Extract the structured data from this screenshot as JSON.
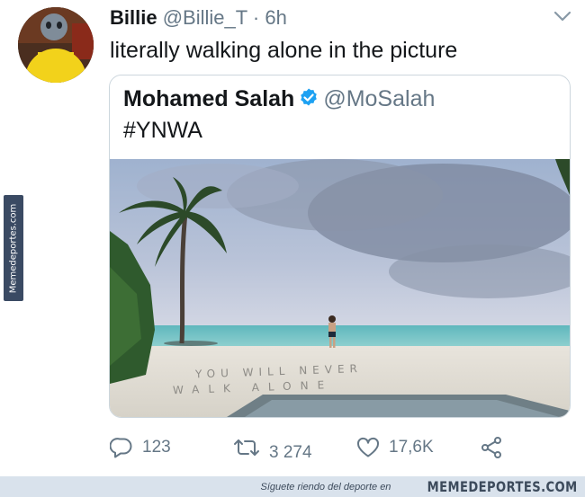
{
  "watermark": {
    "side_text": "Memedeportes.com"
  },
  "tweet": {
    "author_name": "Billie",
    "author_handle": "@Billie_T",
    "separator": "·",
    "time": "6h",
    "text": "literally walking alone in the picture",
    "menu_icon": "chevron-down-icon"
  },
  "quote": {
    "author_name": "Mohamed Salah",
    "verified_icon": "verified-badge-icon",
    "author_handle": "@MoSalah",
    "text": "#YNWA",
    "photo": {
      "description_icon": "beach-photo",
      "sand_text_line1": "YOU WILL NEVER",
      "sand_text_line2": "WALK ALONE"
    }
  },
  "actions": {
    "reply": {
      "icon": "reply-icon",
      "count": "123"
    },
    "retweet": {
      "icon": "retweet-icon",
      "count": "3 274"
    },
    "like": {
      "icon": "heart-icon",
      "count": "17,6K"
    },
    "share": {
      "icon": "share-icon"
    }
  },
  "footer": {
    "tagline": "Síguete riendo del deporte en",
    "brand": "MEMEDEPORTES.COM"
  },
  "colors": {
    "text": "#14171a",
    "secondary": "#657786",
    "verified": "#1da1f2",
    "card_border": "#ccd6dd",
    "footer_bg": "#d9e2ec"
  }
}
